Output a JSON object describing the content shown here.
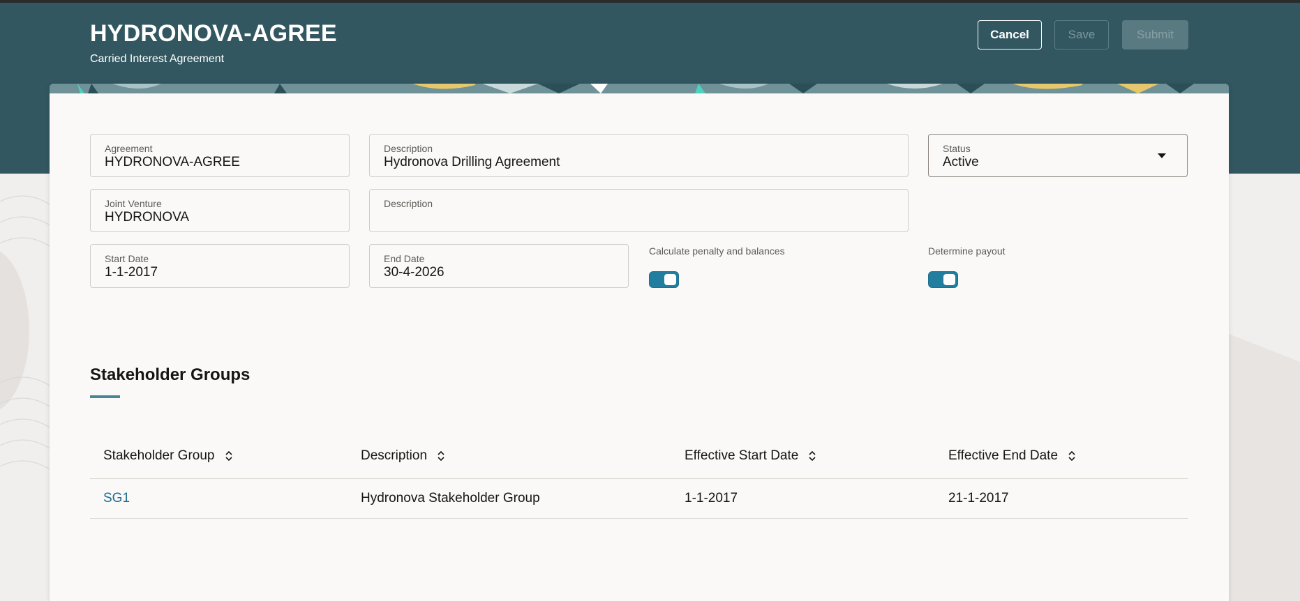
{
  "header": {
    "title": "HYDRONOVA-AGREE",
    "subtitle": "Carried Interest Agreement",
    "buttons": {
      "cancel": "Cancel",
      "save": "Save",
      "submit": "Submit"
    }
  },
  "form": {
    "agreement": {
      "label": "Agreement",
      "value": "HYDRONOVA-AGREE"
    },
    "description": {
      "label": "Description",
      "value": "Hydronova Drilling Agreement"
    },
    "status": {
      "label": "Status",
      "value": "Active"
    },
    "joint_venture": {
      "label": "Joint Venture",
      "value": "HYDRONOVA"
    },
    "description2": {
      "label": "Description",
      "value": ""
    },
    "start_date": {
      "label": "Start Date",
      "value": "1-1-2017"
    },
    "end_date": {
      "label": "End Date",
      "value": "30-4-2026"
    },
    "calc_penalty": {
      "label": "Calculate penalty and balances",
      "on": true
    },
    "determine_payout": {
      "label": "Determine payout",
      "on": true
    }
  },
  "stakeholders": {
    "title": "Stakeholder Groups",
    "columns": [
      "Stakeholder Group",
      "Description",
      "Effective Start Date",
      "Effective End Date"
    ],
    "rows": [
      {
        "group": "SG1",
        "description": "Hydronova Stakeholder Group",
        "start": "1-1-2017",
        "end": "21-1-2017"
      }
    ]
  },
  "colors": {
    "header_bg": "#325760",
    "accent": "#227e9e",
    "link": "#1d6c8c"
  }
}
